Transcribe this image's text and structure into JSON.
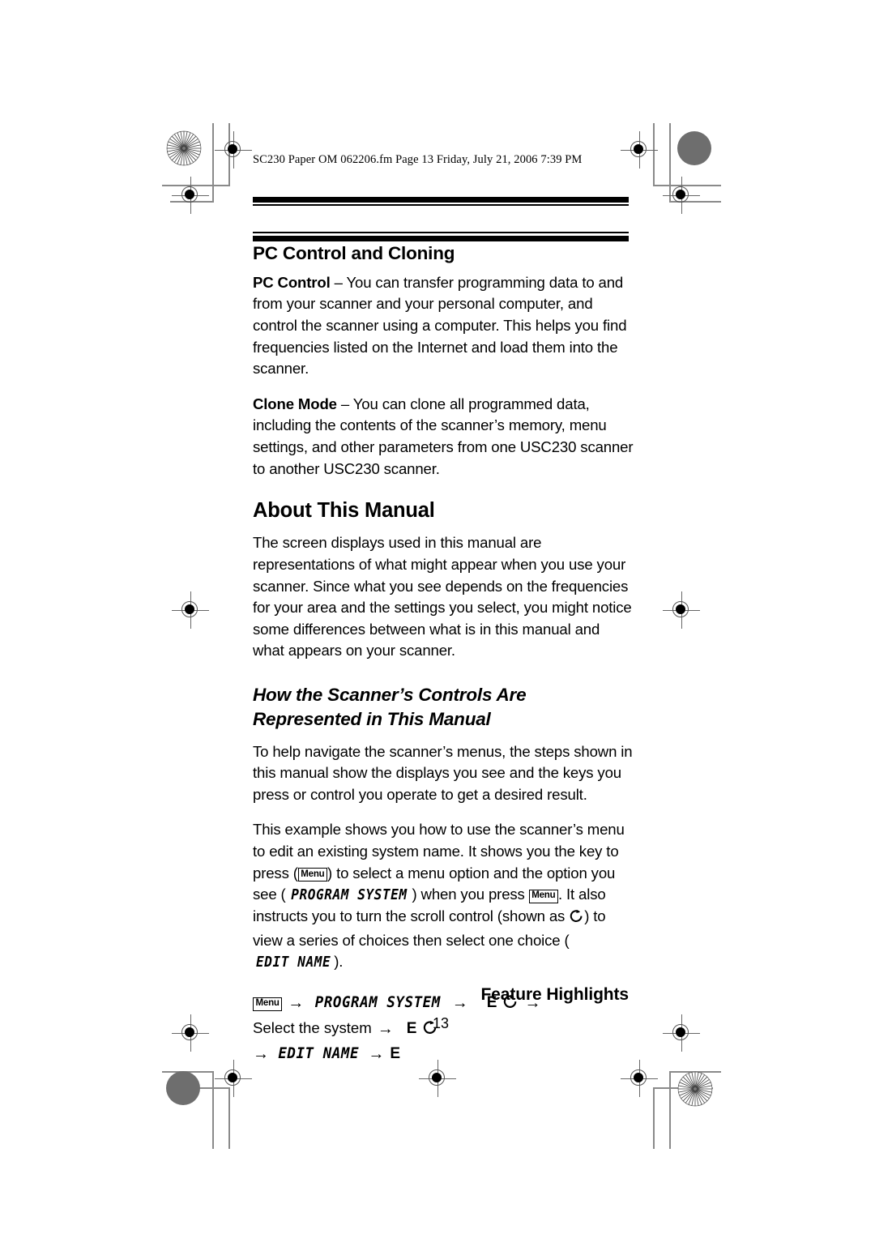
{
  "page": {
    "file_header": "SC230 Paper OM 062206.fm  Page 13  Friday, July 21, 2006  7:39 PM",
    "page_number": "13",
    "footer_title": "Feature Highlights"
  },
  "sections": [
    {
      "heading": "PC Control and Cloning",
      "paragraphs": [
        {
          "lead": "PC Control",
          "text": " – You can transfer programming data to and from your scanner and your personal computer, and control the scanner using a computer. This helps you find frequencies listed on the Internet and load them into the scanner."
        },
        {
          "lead": "Clone Mode",
          "text": " – You can clone all programmed data, including the contents of the scanner’s memory, menu settings, and other parameters from one USC230 scanner to another USC230 scanner."
        }
      ]
    },
    {
      "heading": "About This Manual",
      "paragraphs": [
        {
          "lead": "",
          "text": "The screen displays used in this manual are representations of what might appear when you use your scanner. Since what you see depends on the frequencies for your area and the settings you select, you might notice some differences between what is in this manual and what appears on your scanner."
        }
      ]
    },
    {
      "heading_line1": "How the Scanner’s Controls Are",
      "heading_line2": "Represented in This Manual",
      "paragraph_1": "To help navigate the scanner’s menus, the steps shown in this manual show the displays you see and the keys you press or control you operate to get a desired result."
    }
  ],
  "example_paragraph": {
    "part1": "This example shows you how to use the scanner’s menu to edit an existing system name. It shows you the key to press (",
    "key1": "Menu",
    "part2": ") to select a menu option and the option you see (",
    "lcd1": "PROGRAM SYSTEM",
    "part3": ") when you press ",
    "key2": "Menu",
    "part4": ". It also instructs you to turn the scroll control (shown as ",
    "scroll_symbol": "scroll-control-icon",
    "part5": ") to view a series of choices then select one choice (",
    "lcd2": "EDIT NAME",
    "part6": ")."
  },
  "steps": {
    "line1": {
      "key": "Menu",
      "arrow1": "→",
      "lcd": "PROGRAM SYSTEM",
      "arrow2": "→",
      "e_key": "E",
      "scroll": "scroll-control-icon",
      "arrow3": "→"
    },
    "line2": {
      "text": "Select the system",
      "arrow1": "→",
      "e_key": "E",
      "scroll": "scroll-control-icon"
    },
    "line3": {
      "arrow1": "→",
      "lcd": "EDIT NAME",
      "arrow2": "→",
      "e_key": "E"
    }
  },
  "print_marks": {
    "starburst_top_left": "starburst-target",
    "starburst_bottom_right": "starburst-target",
    "density_top_right": "density-patch",
    "density_bottom_left": "density-patch",
    "registration": "registration-mark"
  },
  "colors": {
    "ink": "#000000",
    "paper": "#ffffff",
    "mark_gray": "#6e6e6e",
    "crop_gray": "#8a8a8a"
  }
}
